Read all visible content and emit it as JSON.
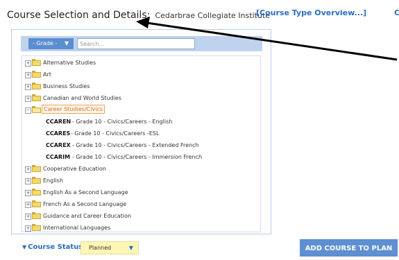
{
  "header": {
    "title": "Course Selection and Details:",
    "school": "Cedarbrae Collegiate Institute",
    "overview_link": "[Course Type Overview...]",
    "edge_link_fragment": "C"
  },
  "toolbar": {
    "grade_label": "- Grade -",
    "search_placeholder": "Search..."
  },
  "tree": {
    "categories": [
      {
        "label": "Alternative Studies"
      },
      {
        "label": "Art"
      },
      {
        "label": "Business Studies"
      },
      {
        "label": "Canadian and World Studies"
      },
      {
        "label": "Career Studies/Civics"
      },
      {
        "label": "Cooperative Education"
      },
      {
        "label": "English"
      },
      {
        "label": "English As a Second Language"
      },
      {
        "label": "French As a Second Language"
      },
      {
        "label": "Guidance and Career Education"
      },
      {
        "label": "International Languages"
      }
    ],
    "courses": [
      {
        "code": "CCAREN",
        "desc": "- Grade 10 - Civics/Careers - English"
      },
      {
        "code": "CCARES",
        "desc": "- Grade 10 - Civics/Careers -ESL"
      },
      {
        "code": "CCAREX",
        "desc": "- Grade 10 - Civics/Careers - Extended French"
      },
      {
        "code": "CCARIM",
        "desc": "- Grade 10 - Civics/Careers - Immersion French"
      }
    ]
  },
  "status": {
    "label": "Course Status:",
    "value": "Planned"
  },
  "actions": {
    "add_label": "ADD COURSE TO PLAN"
  },
  "colors": {
    "accent": "#2a6cc2",
    "button": "#5d8fd2",
    "selected_text": "#e06b12",
    "status_bg": "#fdf6b5"
  }
}
